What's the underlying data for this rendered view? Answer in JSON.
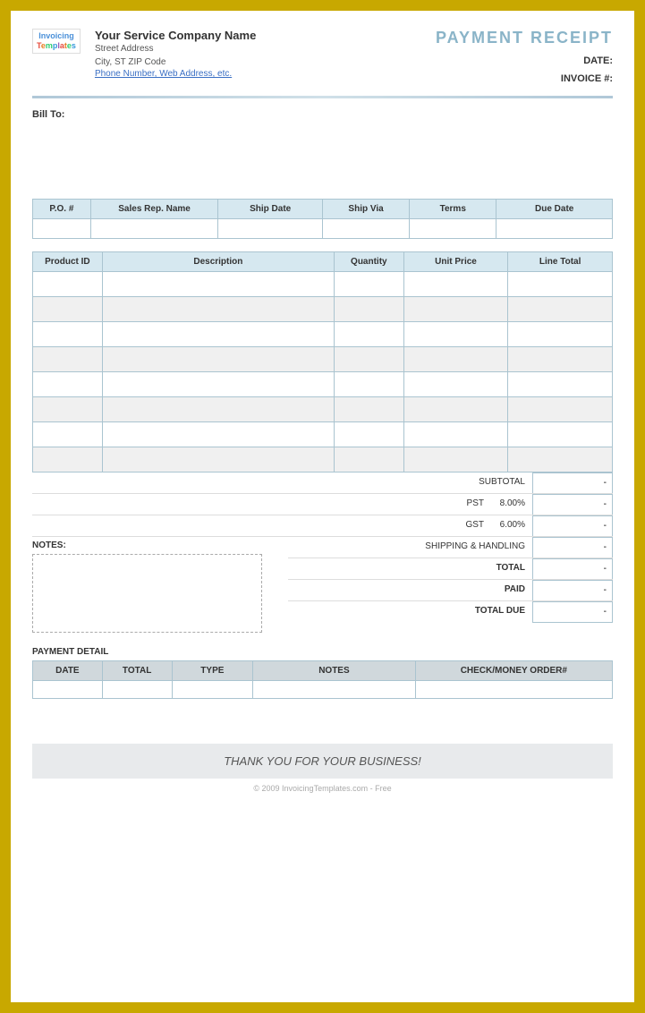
{
  "document": {
    "title": "PAYMENT RECEIPT",
    "company": {
      "name": "Your Service Company Name",
      "street": "Street Address",
      "city": "City, ST  ZIP Code",
      "phone": "Phone Number, Web Address, etc."
    },
    "logo": {
      "invoicing": "Invoicing",
      "templates": "Templates"
    },
    "header_right": {
      "date_label": "DATE:",
      "invoice_label": "INVOICE #:",
      "date_value": "",
      "invoice_value": ""
    },
    "bill_to_label": "Bill To:",
    "order_table": {
      "headers": [
        "P.O. #",
        "Sales Rep. Name",
        "Ship Date",
        "Ship Via",
        "Terms",
        "Due Date"
      ]
    },
    "products_table": {
      "headers": [
        "Product ID",
        "Description",
        "Quantity",
        "Unit Price",
        "Line Total"
      ],
      "rows": 8
    },
    "totals": {
      "subtotal_label": "SUBTOTAL",
      "subtotal_value": "-",
      "pst_label": "PST",
      "pst_rate": "8.00%",
      "pst_value": "-",
      "gst_label": "GST",
      "gst_rate": "6.00%",
      "gst_value": "-",
      "shipping_label": "SHIPPING & HANDLING",
      "shipping_value": "-",
      "total_label": "TOTAL",
      "total_value": "-",
      "paid_label": "PAID",
      "paid_value": "-",
      "total_due_label": "TOTAL DUE",
      "total_due_value": "-"
    },
    "notes_label": "NOTES:",
    "payment_detail": {
      "section_label": "PAYMENT DETAIL",
      "headers": [
        "DATE",
        "TOTAL",
        "TYPE",
        "NOTES",
        "CHECK/MONEY ORDER#"
      ]
    },
    "footer": {
      "thank_you": "THANK YOU FOR YOUR BUSINESS!",
      "copyright": "© 2009 InvoicingTemplates.com - Free"
    }
  }
}
